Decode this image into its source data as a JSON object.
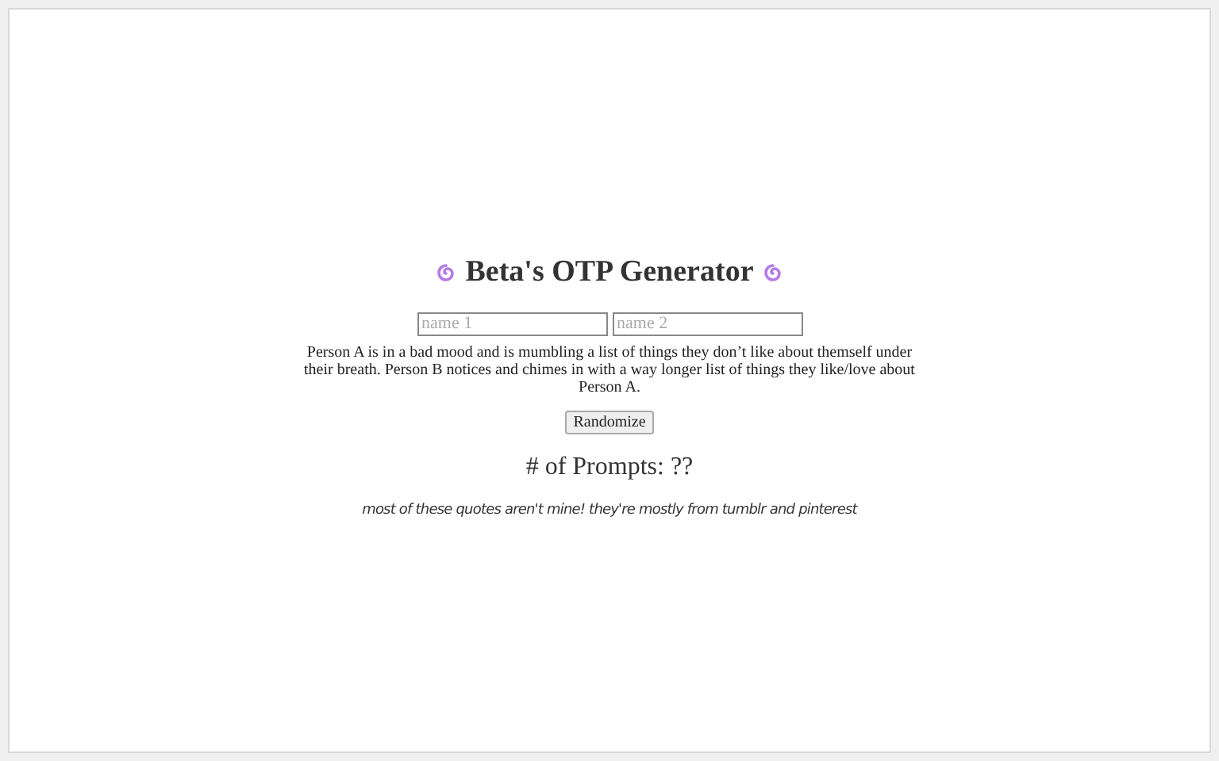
{
  "title": "Beta's OTP Generator",
  "fields": [
    {
      "placeholder": "name 1"
    },
    {
      "placeholder": "name 2"
    }
  ],
  "prompt": "Person A is in a bad mood and is mumbling a list of things they don’t like about themself under their breath. Person B notices and chimes in with a way longer list of things they like/love about Person A.",
  "button": "Randomize",
  "count": "# of Prompts: ??",
  "note": "most of these quotes aren't mine! they're mostly from tumblr and pinterest"
}
